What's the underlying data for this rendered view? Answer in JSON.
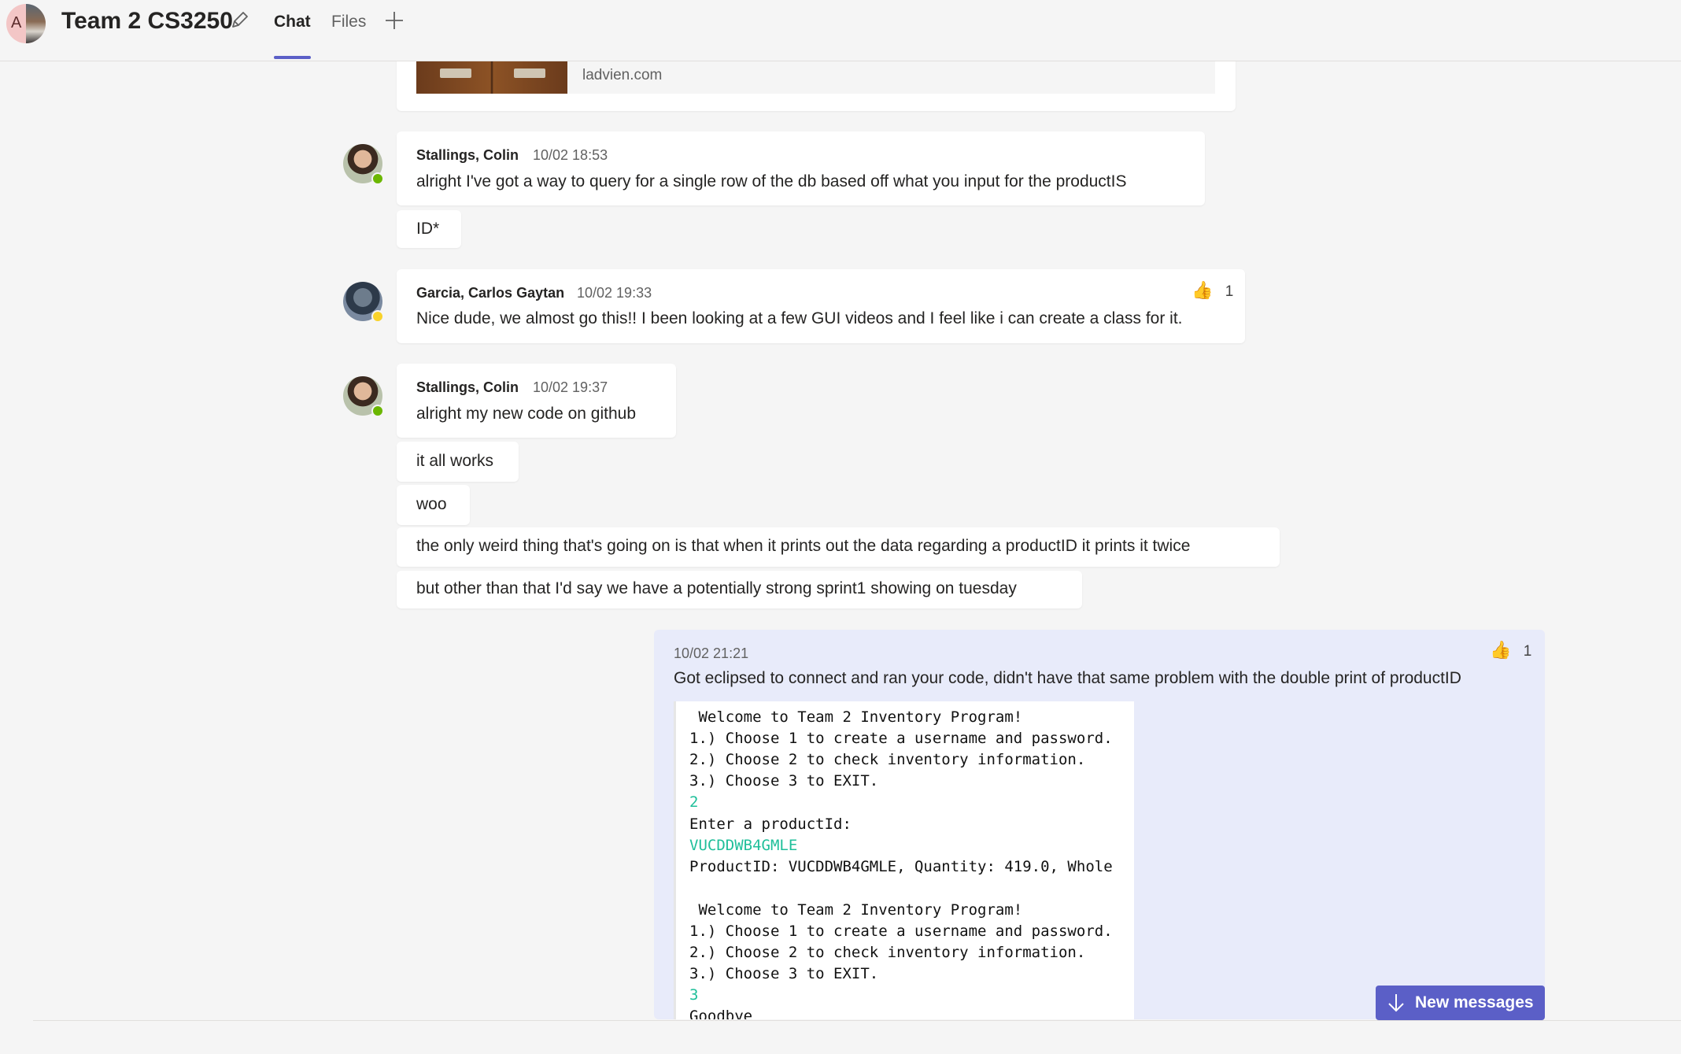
{
  "header": {
    "avatar_letter": "A",
    "title": "Team 2 CS3250",
    "tabs": [
      {
        "label": "Chat",
        "active": true
      },
      {
        "label": "Files",
        "active": false
      }
    ]
  },
  "link_preview": {
    "domain": "ladvien.com"
  },
  "messages": [
    {
      "sender": "Stallings, Colin",
      "time": "10/02 18:53",
      "lines": [
        "alright I've got a way to query for a single row of the db based off what you input for the productIS",
        "ID*"
      ]
    },
    {
      "sender": "Garcia, Carlos Gaytan",
      "time": "10/02 19:33",
      "reaction_count": "1",
      "lines": [
        "Nice dude, we almost go this!! I been looking at a few GUI videos and I feel like i can create a class for it."
      ]
    },
    {
      "sender": "Stallings, Colin",
      "time": "10/02 19:37",
      "lines": [
        "alright my new code on github",
        "it all works",
        "woo",
        "the only weird thing that's going on is that when it prints out the data regarding a productID it prints it twice",
        "but other than that I'd say we have a potentially strong sprint1 showing on tuesday"
      ]
    }
  ],
  "self_message": {
    "time": "10/02 21:21",
    "reaction_count": "1",
    "text": "Got eclipsed to connect and ran your code, didn't have that same problem with the double print of productID",
    "console_lines": [
      " Welcome to Team 2 Inventory Program!",
      "1.) Choose 1 to create a username and password.",
      "2.) Choose 2 to check inventory information.",
      "3.) Choose 3 to EXIT.",
      "2",
      "Enter a productId:",
      "VUCDDWB4GMLE",
      "ProductID: VUCDDWB4GMLE, Quantity: 419.0, Whole",
      "",
      " Welcome to Team 2 Inventory Program!",
      "1.) Choose 1 to create a username and password.",
      "2.) Choose 2 to check inventory information.",
      "3.) Choose 3 to EXIT.",
      "3",
      "Goodbye"
    ]
  },
  "new_messages_button": {
    "label": "New messages"
  },
  "colors": {
    "accent": "#5b5fc7",
    "self_bubble": "#e8ebfa",
    "console_input": "#1fbf9a",
    "presence_available": "#6bb700",
    "presence_away": "#f8d22a"
  },
  "icons": [
    "edit-icon",
    "plus-icon",
    "thumbs-up-icon",
    "arrow-down-icon"
  ]
}
